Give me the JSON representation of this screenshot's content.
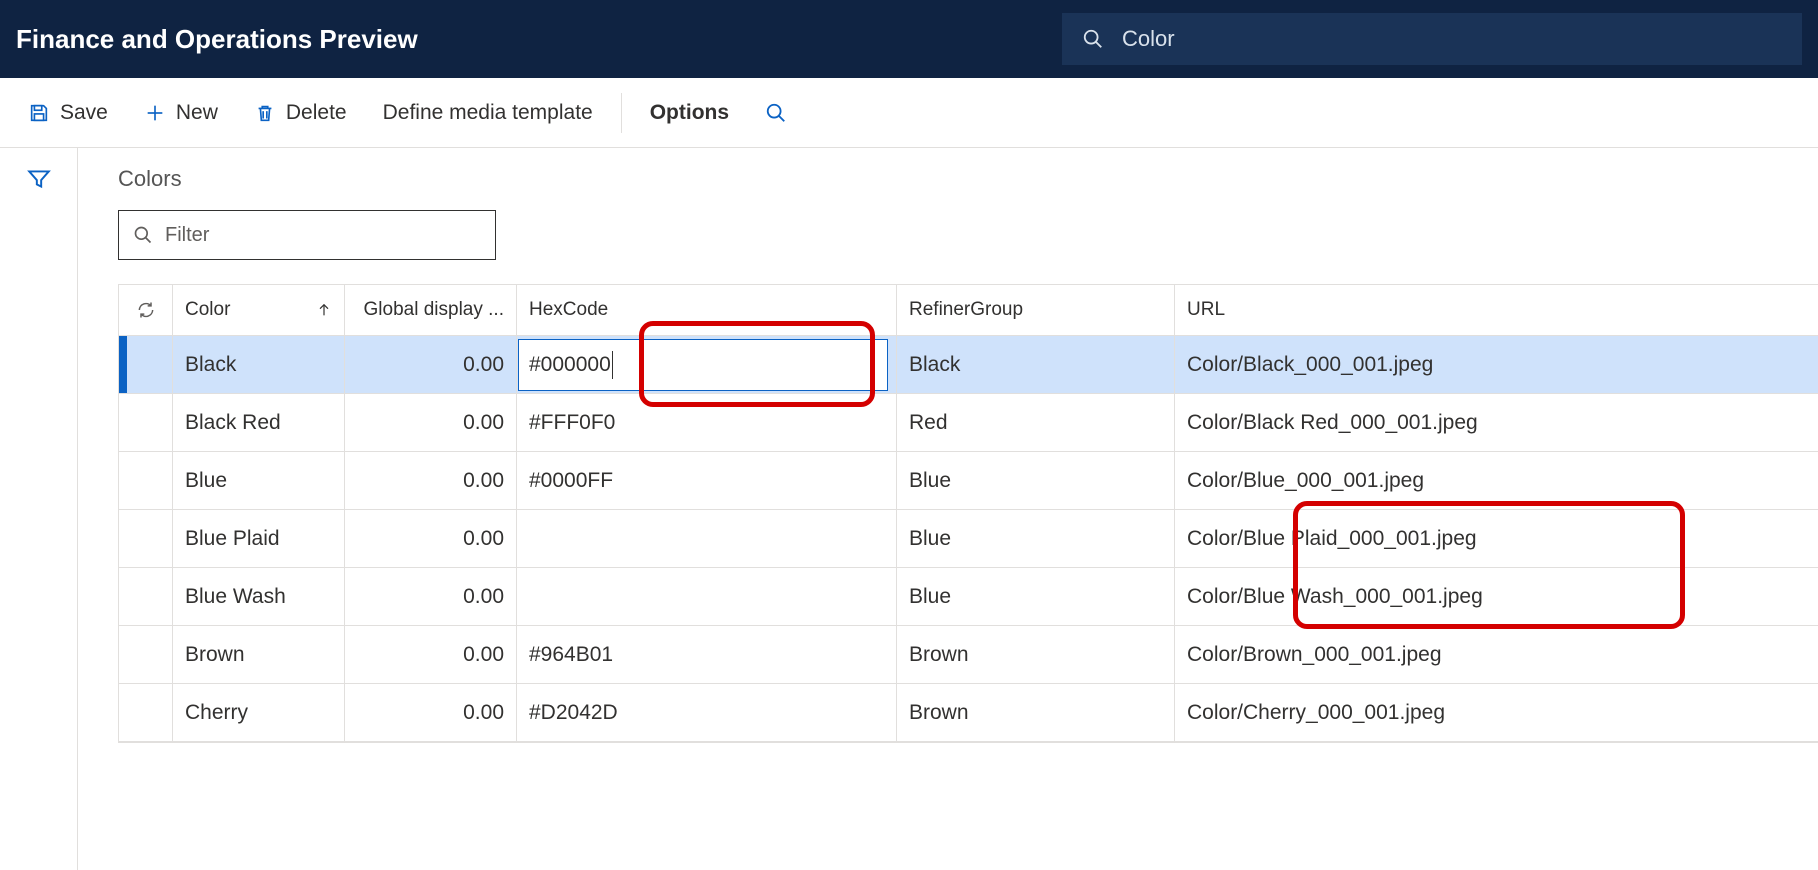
{
  "header": {
    "title": "Finance and Operations Preview",
    "search_value": "Color"
  },
  "toolbar": {
    "save": "Save",
    "new": "New",
    "delete": "Delete",
    "define_media": "Define media template",
    "options": "Options"
  },
  "section": {
    "title": "Colors",
    "filter_placeholder": "Filter"
  },
  "columns": {
    "color": "Color",
    "global": "Global display ...",
    "hex": "HexCode",
    "refiner": "RefinerGroup",
    "url": "URL"
  },
  "rows": [
    {
      "color": "Black",
      "global": "0.00",
      "hex": "#000000",
      "refiner": "Black",
      "url": "Color/Black_000_001.jpeg",
      "selected": true
    },
    {
      "color": "Black Red",
      "global": "0.00",
      "hex": "#FFF0F0",
      "refiner": "Red",
      "url": "Color/Black Red_000_001.jpeg",
      "selected": false
    },
    {
      "color": "Blue",
      "global": "0.00",
      "hex": "#0000FF",
      "refiner": "Blue",
      "url": "Color/Blue_000_001.jpeg",
      "selected": false
    },
    {
      "color": "Blue Plaid",
      "global": "0.00",
      "hex": "",
      "refiner": "Blue",
      "url": "Color/Blue Plaid_000_001.jpeg",
      "selected": false
    },
    {
      "color": "Blue Wash",
      "global": "0.00",
      "hex": "",
      "refiner": "Blue",
      "url": "Color/Blue Wash_000_001.jpeg",
      "selected": false
    },
    {
      "color": "Brown",
      "global": "0.00",
      "hex": "#964B01",
      "refiner": "Brown",
      "url": "Color/Brown_000_001.jpeg",
      "selected": false
    },
    {
      "color": "Cherry",
      "global": "0.00",
      "hex": "#D2042D",
      "refiner": "Brown",
      "url": "Color/Cherry_000_001.jpeg",
      "selected": false
    }
  ]
}
